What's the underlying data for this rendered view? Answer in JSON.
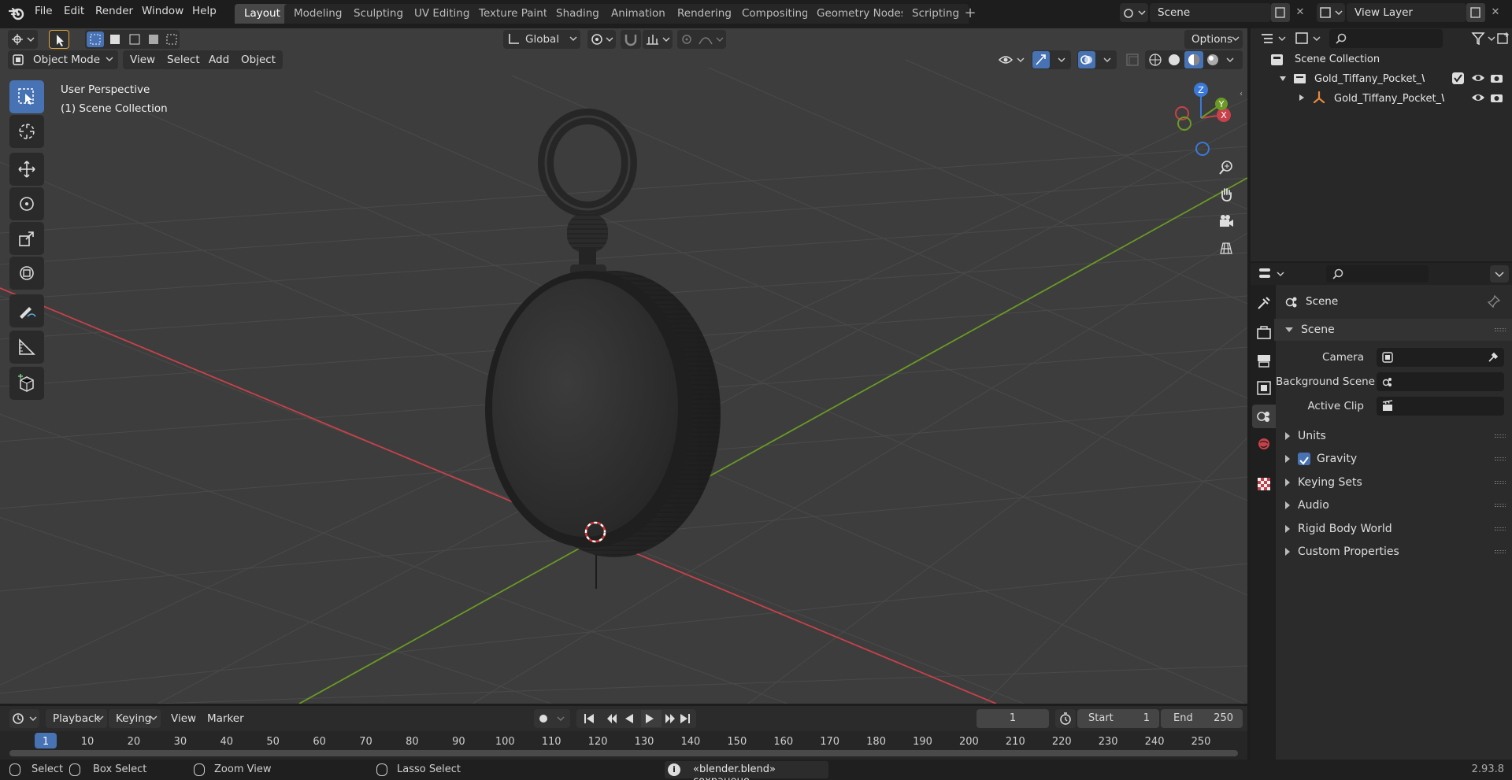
{
  "top_menu": [
    "File",
    "Edit",
    "Render",
    "Window",
    "Help"
  ],
  "workspace_tabs": [
    "Layout",
    "Modeling",
    "Sculpting",
    "UV Editing",
    "Texture Paint",
    "Shading",
    "Animation",
    "Rendering",
    "Compositing",
    "Geometry Nodes",
    "Scripting"
  ],
  "active_tab": "Layout",
  "scene_field": "Scene",
  "view_layer_field": "View Layer",
  "viewport": {
    "mode": "Object Mode",
    "menus": [
      "View",
      "Select",
      "Add",
      "Object"
    ],
    "transform_orientation": "Global",
    "options_label": "Options",
    "overlay_line1": "User Perspective",
    "overlay_line2": "(1) Scene Collection",
    "gizmo_axes": {
      "x": "X",
      "y": "Y",
      "z": "Z"
    }
  },
  "outliner": {
    "root": "Scene Collection",
    "collection": "Gold_Tiffany_Pocket_Watch_C",
    "object": "Gold_Tiffany_Pocket_Wa"
  },
  "properties": {
    "context_name": "Scene",
    "panel_title": "Scene",
    "camera_label": "Camera",
    "background_scene_label": "Background Scene",
    "active_clip_label": "Active Clip",
    "sections": [
      "Units",
      "Gravity",
      "Keying Sets",
      "Audio",
      "Rigid Body World",
      "Custom Properties"
    ],
    "gravity_checked": true
  },
  "timeline": {
    "menus": [
      "Playback",
      "Keying",
      "View",
      "Marker"
    ],
    "current_frame": "1",
    "start_label": "Start",
    "start_value": "1",
    "end_label": "End",
    "end_value": "250",
    "ticks": [
      "1",
      "10",
      "20",
      "30",
      "40",
      "50",
      "60",
      "70",
      "80",
      "90",
      "100",
      "110",
      "120",
      "130",
      "140",
      "150",
      "160",
      "170",
      "180",
      "190",
      "200",
      "210",
      "220",
      "230",
      "240",
      "250"
    ]
  },
  "statusbar": {
    "select": "Select",
    "box_select": "Box Select",
    "zoom_view": "Zoom View",
    "lasso_select": "Lasso Select",
    "message": "«blender.blend» сохранено",
    "version": "2.93.8"
  },
  "colors": {
    "accent": "#4772b3",
    "x_axis": "#c8414a",
    "y_axis": "#6a9a25",
    "z_axis": "#3b79d8",
    "viewport_bg": "#3d3d3d"
  }
}
